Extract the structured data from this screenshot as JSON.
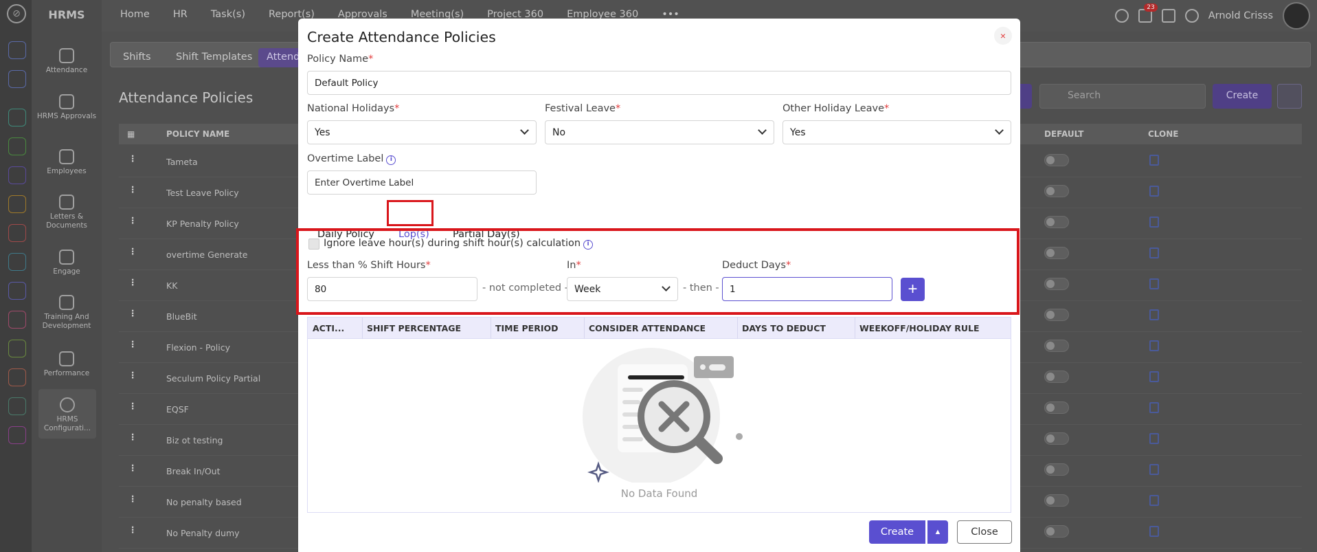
{
  "app": {
    "brand": "HRMS"
  },
  "topnav": [
    "Home",
    "HR",
    "Task(s)",
    "Report(s)",
    "Approvals",
    "Meeting(s)",
    "Project 360",
    "Employee 360"
  ],
  "user": {
    "name": "Arnold Crisss",
    "notifications": "23"
  },
  "sidebar": [
    {
      "label": "Attendance"
    },
    {
      "label": "HRMS Approvals"
    },
    {
      "label": "Employees"
    },
    {
      "label": "Letters & Documents"
    },
    {
      "label": "Engage"
    },
    {
      "label": "Training And Development"
    },
    {
      "label": "Performance"
    },
    {
      "label": "HRMS Configurati..."
    }
  ],
  "bg": {
    "tabs": [
      "Shifts",
      "Shift Templates",
      "Attend"
    ],
    "title": "Attendance Policies",
    "search_placeholder": "Search",
    "create_label": "Create",
    "columns": {
      "policy_name": "POLICY NAME",
      "default": "DEFAULT",
      "clone": "CLONE"
    },
    "rows": [
      "Tameta",
      "Test Leave Policy",
      "KP Penalty Policy",
      "overtime Generate",
      "KK",
      "BlueBit",
      "Flexion - Policy",
      "Seculum Policy Partial",
      "EQSF",
      "Biz ot testing",
      "Break In/Out",
      "No penalty based",
      "No Penalty dumy"
    ]
  },
  "modal": {
    "title": "Create Attendance Policies",
    "close_icon": "×",
    "policy_name": {
      "label": "Policy Name",
      "value": "Default Policy"
    },
    "national_holidays": {
      "label": "National Holidays",
      "value": "Yes"
    },
    "festival_leave": {
      "label": "Festival Leave",
      "value": "No"
    },
    "other_holiday_leave": {
      "label": "Other Holiday Leave",
      "value": "Yes"
    },
    "overtime_label": {
      "label": "Overtime Label",
      "placeholder": "Enter Overtime Label"
    },
    "tabs": [
      "Daily Policy",
      "Lop(s)",
      "Partial Day(s)"
    ],
    "ignore_leave": "Ignore leave hour(s) during shift hour(s) calculation",
    "less_than": {
      "label": "Less than % Shift Hours",
      "value": "80"
    },
    "not_completed": "- not completed -",
    "in": {
      "label": "In",
      "value": "Week"
    },
    "then": "- then -",
    "deduct_days": {
      "label": "Deduct Days",
      "value": "1"
    },
    "plus": "+",
    "table_headers": [
      "ACTI...",
      "SHIFT PERCENTAGE",
      "TIME PERIOD",
      "CONSIDER ATTENDANCE",
      "DAYS TO DEDUCT",
      "WEEKOFF/HOLIDAY RULE"
    ],
    "no_data": "No Data Found",
    "create_btn": "Create",
    "close_btn": "Close"
  }
}
